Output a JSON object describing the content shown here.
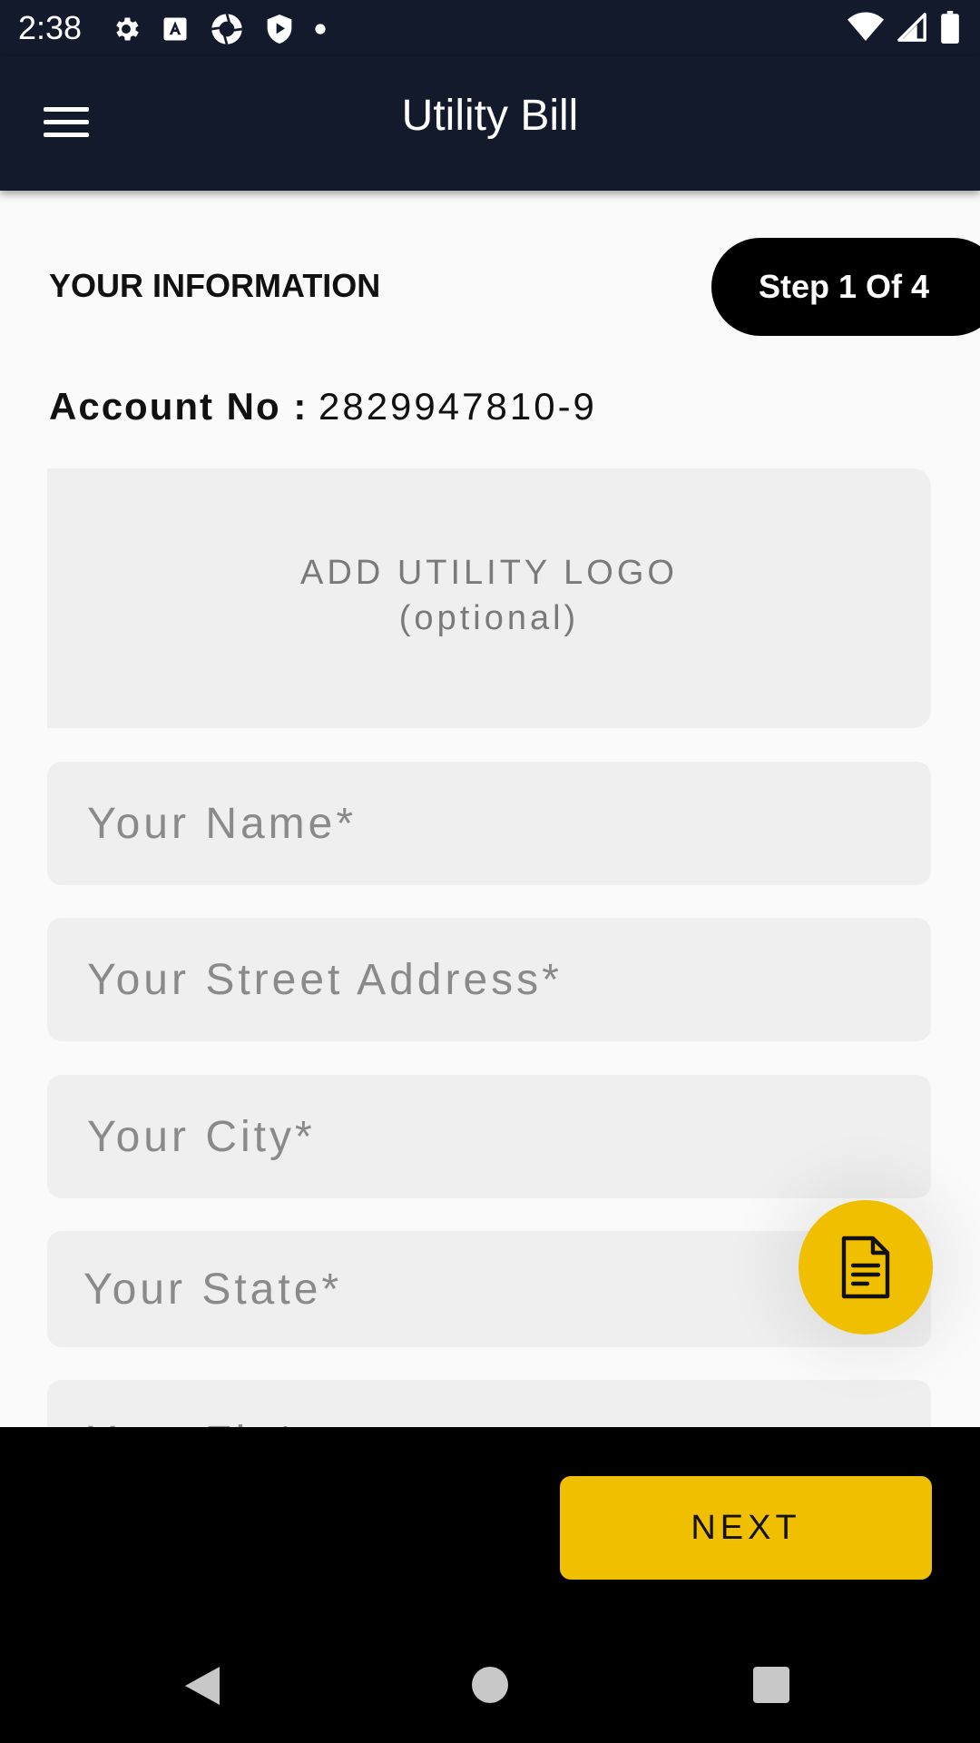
{
  "status_bar": {
    "time": "2:38",
    "left_icons": [
      "gear-icon",
      "font-a-icon",
      "camera-shutter-icon",
      "shield-play-icon",
      "dot-icon"
    ],
    "right_icons": [
      "wifi-icon",
      "signal-icon",
      "battery-icon"
    ]
  },
  "app_bar": {
    "title": "Utility Bill",
    "menu_icon": "hamburger-icon"
  },
  "section": {
    "label": "YOUR INFORMATION",
    "step": "Step 1 Of 4"
  },
  "account": {
    "label": "Account No :",
    "value": "2829947810-9"
  },
  "logo_upload": {
    "line1": "ADD UTILITY LOGO",
    "line2": "(optional)"
  },
  "form": {
    "name_placeholder": "Your Name*",
    "street_placeholder": "Your Street Address*",
    "city_placeholder": "Your City*",
    "state_placeholder": "Your State*",
    "zip_placeholder": "Your Zip*"
  },
  "fab": {
    "icon": "document-icon"
  },
  "footer": {
    "next_label": "NEXT"
  },
  "colors": {
    "app_bar": "#121a2b",
    "accent": "#f0c000",
    "field_bg": "#efefef",
    "page_bg": "#fafafa"
  }
}
